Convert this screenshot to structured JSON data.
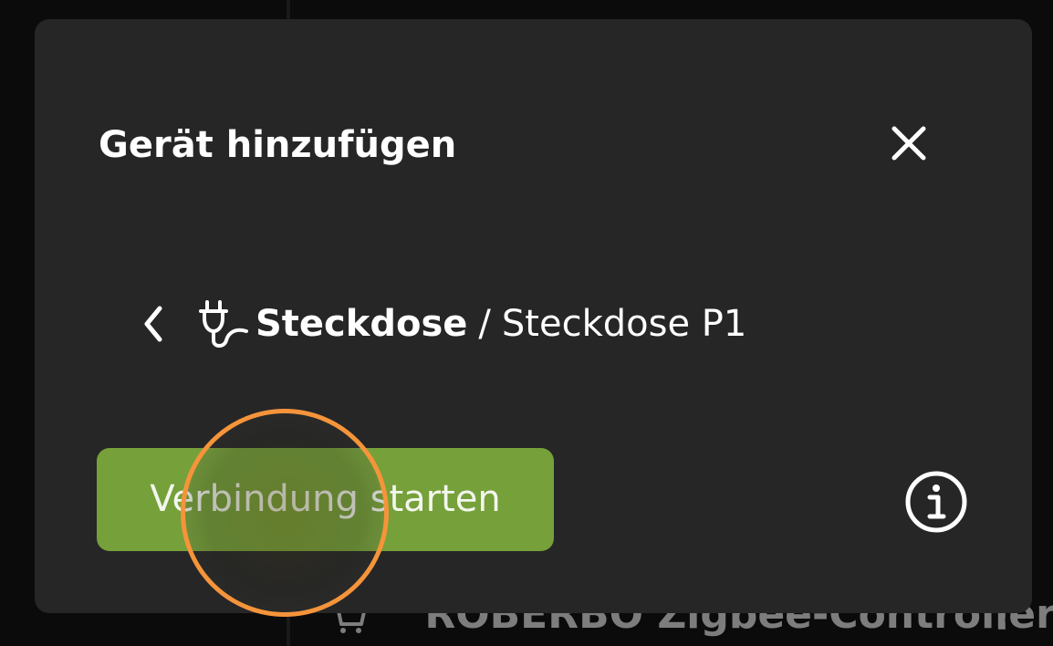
{
  "dialog": {
    "title": "Gerät hinzufügen",
    "close_icon": "close-icon",
    "breadcrumb": {
      "back_icon": "chevron-left-icon",
      "category_icon": "plug-icon",
      "category": "Steckdose",
      "separator": "/",
      "device": "Steckdose P1"
    },
    "start_button_label": "Verbindung starten",
    "info_icon": "info-icon"
  },
  "background": {
    "row_label": "ROBERBO Zigbee-Controller",
    "row_icon": "cart-icon",
    "row_menu": "⋮"
  },
  "colors": {
    "dialog_bg": "#262627",
    "page_bg": "#0b0b0b",
    "primary_button": "#76a03a",
    "click_highlight": "#f5943a",
    "text": "#ffffff"
  }
}
